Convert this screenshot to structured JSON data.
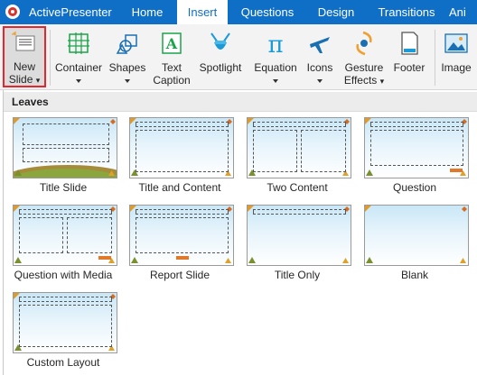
{
  "app": {
    "name": "ActivePresenter"
  },
  "tabs": [
    {
      "label": "Home",
      "active": false
    },
    {
      "label": "Insert",
      "active": true
    },
    {
      "label": "Questions",
      "active": false
    },
    {
      "label": "Design",
      "active": false
    },
    {
      "label": "Transitions",
      "active": false
    },
    {
      "label": "Ani",
      "active": false
    }
  ],
  "ribbon": {
    "new_slide": {
      "line1": "New",
      "line2": "Slide",
      "icon": "new-slide-icon"
    },
    "container": {
      "label": "Container",
      "icon": "container-icon"
    },
    "shapes": {
      "label": "Shapes",
      "icon": "shapes-icon"
    },
    "text_caption": {
      "line1": "Text",
      "line2": "Caption",
      "icon": "text-caption-icon"
    },
    "spotlight": {
      "label": "Spotlight",
      "icon": "spotlight-icon"
    },
    "equation": {
      "label": "Equation",
      "icon": "equation-icon"
    },
    "icons": {
      "label": "Icons",
      "icon": "airplane-icon"
    },
    "gesture_effects": {
      "line1": "Gesture",
      "line2": "Effects",
      "icon": "gesture-effects-icon"
    },
    "footer": {
      "label": "Footer",
      "icon": "footer-icon"
    },
    "image": {
      "label": "Image",
      "icon": "image-icon"
    }
  },
  "gallery": {
    "title": "Leaves",
    "layouts": [
      {
        "name": "Title Slide"
      },
      {
        "name": "Title and Content"
      },
      {
        "name": "Two Content"
      },
      {
        "name": "Question"
      },
      {
        "name": "Question with Media"
      },
      {
        "name": "Report Slide"
      },
      {
        "name": "Title Only"
      },
      {
        "name": "Blank"
      },
      {
        "name": "Custom Layout"
      }
    ]
  },
  "colors": {
    "titlebar": "#0f6fc6",
    "highlight_border": "#e5262c",
    "accent_orange": "#f0a030",
    "accent_teal": "#1a9bd7"
  }
}
